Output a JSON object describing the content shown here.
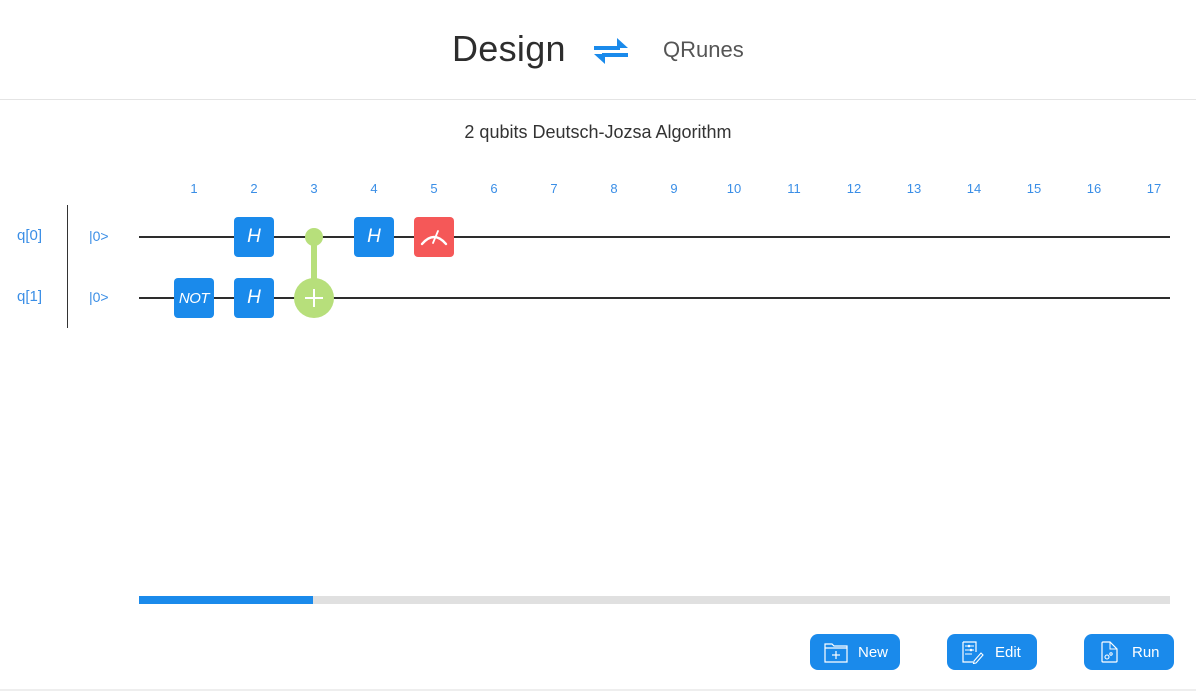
{
  "header": {
    "active_mode": "Design",
    "swap_icon": "swap-arrows-icon",
    "alternate_mode": "QRunes",
    "accent_color": "#1a8aeb"
  },
  "circuit": {
    "title": "2 qubits Deutsch-Jozsa Algorithm",
    "columns": [
      "1",
      "2",
      "3",
      "4",
      "5",
      "6",
      "7",
      "8",
      "9",
      "10",
      "11",
      "12",
      "13",
      "14",
      "15",
      "16",
      "17"
    ],
    "qubits": [
      {
        "label": "q[0]",
        "initial_state": "|0>"
      },
      {
        "label": "q[1]",
        "initial_state": "|0>"
      }
    ],
    "gates": [
      {
        "type": "NOT",
        "label": "NOT",
        "qubit": 1,
        "column": 1,
        "color": "#1a8aeb"
      },
      {
        "type": "H",
        "label": "H",
        "qubit": 0,
        "column": 2,
        "color": "#1a8aeb"
      },
      {
        "type": "H",
        "label": "H",
        "qubit": 1,
        "column": 2,
        "color": "#1a8aeb"
      },
      {
        "type": "CNOT",
        "control": 0,
        "target": 1,
        "column": 3,
        "color": "#b7df7b"
      },
      {
        "type": "H",
        "label": "H",
        "qubit": 0,
        "column": 4,
        "color": "#1a8aeb"
      },
      {
        "type": "Measure",
        "icon": "meter-icon",
        "qubit": 0,
        "column": 5,
        "color": "#f55858"
      }
    ]
  },
  "scrollbar": {
    "visible_fraction_start": 0,
    "thumb_fraction": 0.169
  },
  "actions": {
    "new": {
      "label": "New",
      "icon": "folder-plus-icon"
    },
    "edit": {
      "label": "Edit",
      "icon": "edit-document-icon"
    },
    "run": {
      "label": "Run",
      "icon": "run-document-icon"
    }
  }
}
